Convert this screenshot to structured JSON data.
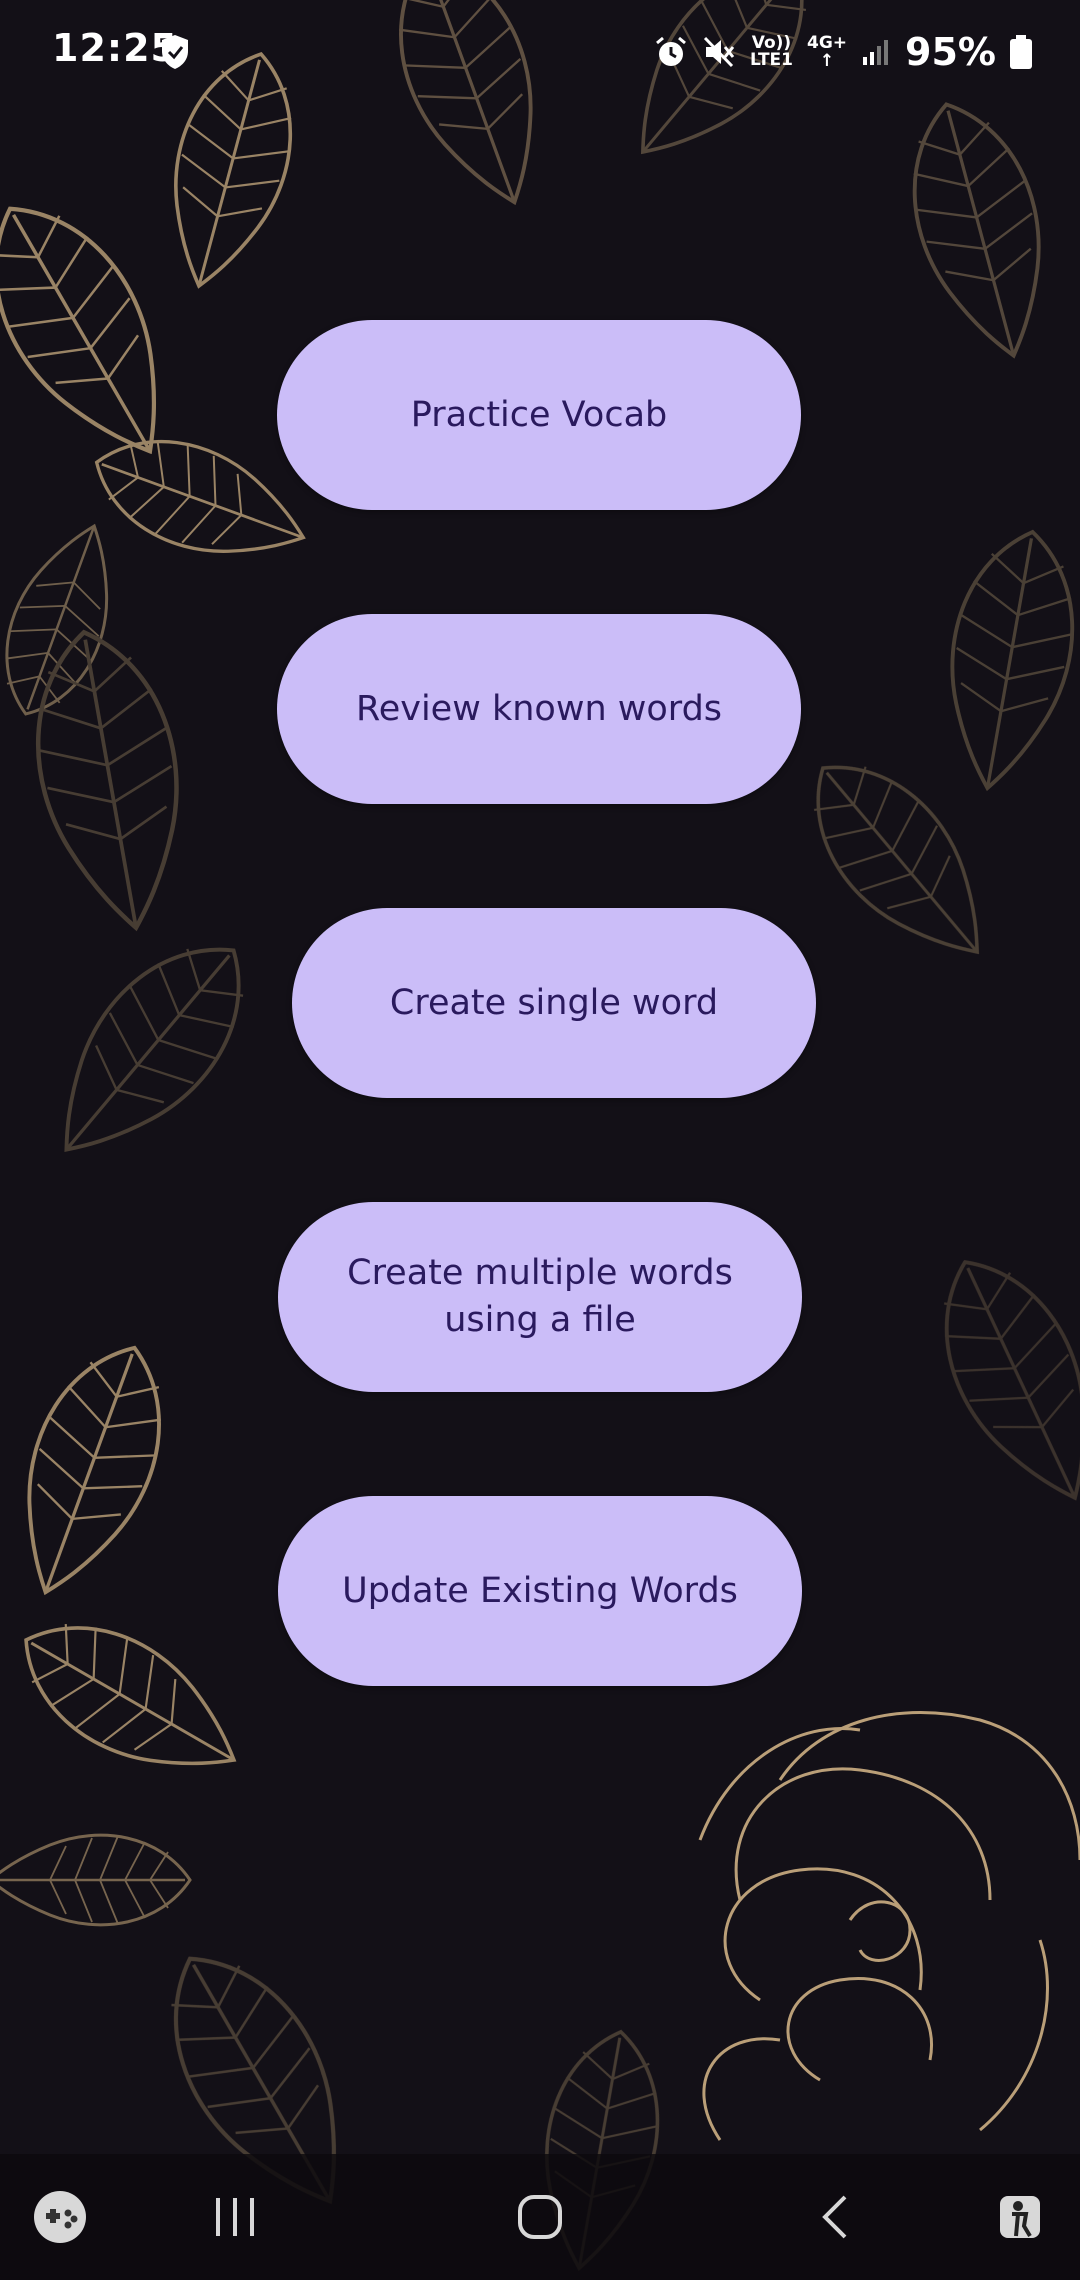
{
  "status_bar": {
    "time": "12:25",
    "battery_percent": "95%",
    "volte_top": "Vo))",
    "volte_bottom": "LTE1",
    "network_type": "4G+",
    "network_arrows": "↑",
    "icons": [
      "shield-icon",
      "alarm-icon",
      "mute-icon",
      "signal-icon",
      "battery-icon"
    ]
  },
  "menu": {
    "buttons": [
      {
        "label": "Practice Vocab"
      },
      {
        "label": "Review known words"
      },
      {
        "label": "Create single word"
      },
      {
        "label_line1": "Create multiple words",
        "label_line2": "using a file"
      },
      {
        "label": "Update Existing Words"
      }
    ]
  },
  "nav_bar": {
    "icons": [
      "game-launcher-icon",
      "recents-icon",
      "home-icon",
      "back-icon",
      "accessibility-icon"
    ]
  },
  "colors": {
    "background": "#131017",
    "button_fill": "#cbbdf8",
    "button_text": "#2a1a5e",
    "leaf_outline": "#b89a72"
  }
}
